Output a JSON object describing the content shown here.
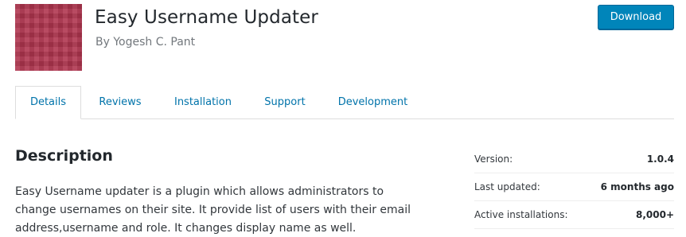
{
  "plugin": {
    "title": "Easy Username Updater",
    "author": "By Yogesh C. Pant",
    "download_label": "Download",
    "icon_color": "#b0364f",
    "accent_color": "#0085ba"
  },
  "tabs": [
    {
      "label": "Details",
      "active": true
    },
    {
      "label": "Reviews",
      "active": false
    },
    {
      "label": "Installation",
      "active": false
    },
    {
      "label": "Support",
      "active": false
    },
    {
      "label": "Development",
      "active": false
    }
  ],
  "description": {
    "heading": "Description",
    "lines": [
      "Easy Username updater is a plugin which allows administrators to",
      "change usernames on their site. It provide list of users with their email",
      "address,username and role. It changes display name as well."
    ]
  },
  "meta": [
    {
      "label": "Version:",
      "value": "1.0.4"
    },
    {
      "label": "Last updated:",
      "value": "6 months ago"
    },
    {
      "label": "Active installations:",
      "value": "8,000+"
    }
  ]
}
